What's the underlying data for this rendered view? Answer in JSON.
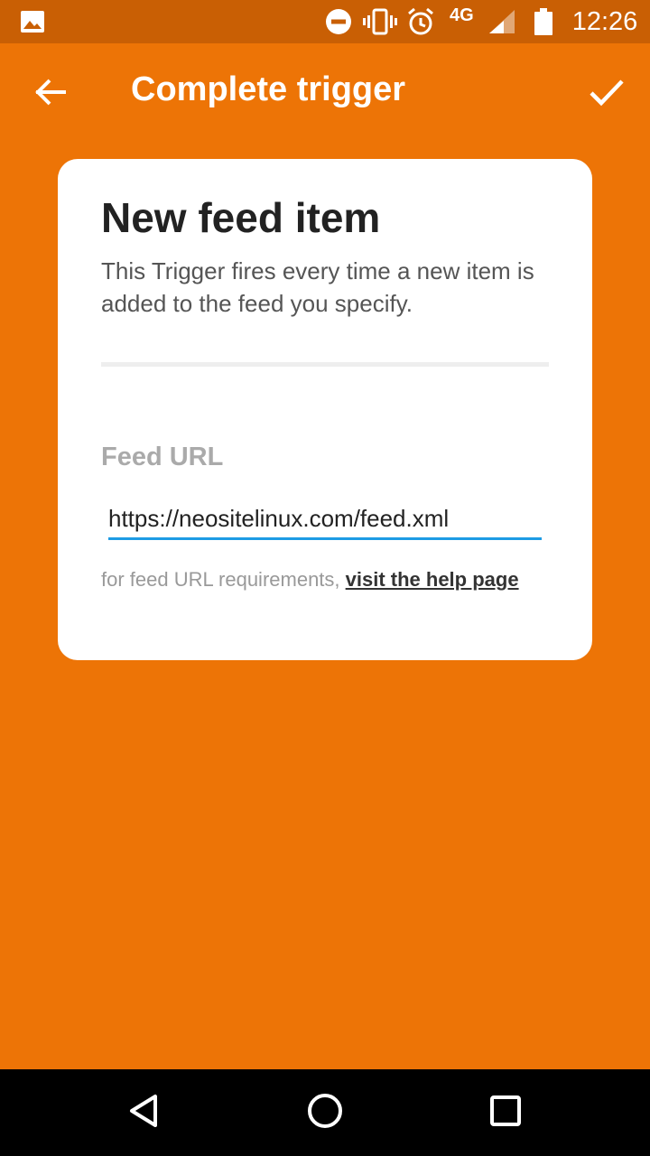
{
  "status_bar": {
    "time": "12:26",
    "network": "4G",
    "icons": [
      "image-notification-icon",
      "do-not-disturb-icon",
      "vibrate-icon",
      "alarm-icon",
      "signal-icon",
      "battery-icon"
    ]
  },
  "app_bar": {
    "title": "Complete trigger",
    "back_icon": "arrow-left-icon",
    "confirm_icon": "checkmark-icon"
  },
  "card": {
    "heading": "New feed item",
    "description": "This Trigger fires every time a new item is added to the feed you specify.",
    "field_label": "Feed URL",
    "feed_url_value": "https://neositelinux.com/feed.xml",
    "help_prefix": "for feed URL requirements, ",
    "help_link": "visit the help page"
  },
  "nav_bar": {
    "icons": [
      "back-triangle-icon",
      "home-circle-icon",
      "recents-square-icon"
    ]
  },
  "colors": {
    "brand_orange": "#ED7406",
    "status_bar": "#C95F04",
    "input_underline": "#1E9BE4"
  }
}
